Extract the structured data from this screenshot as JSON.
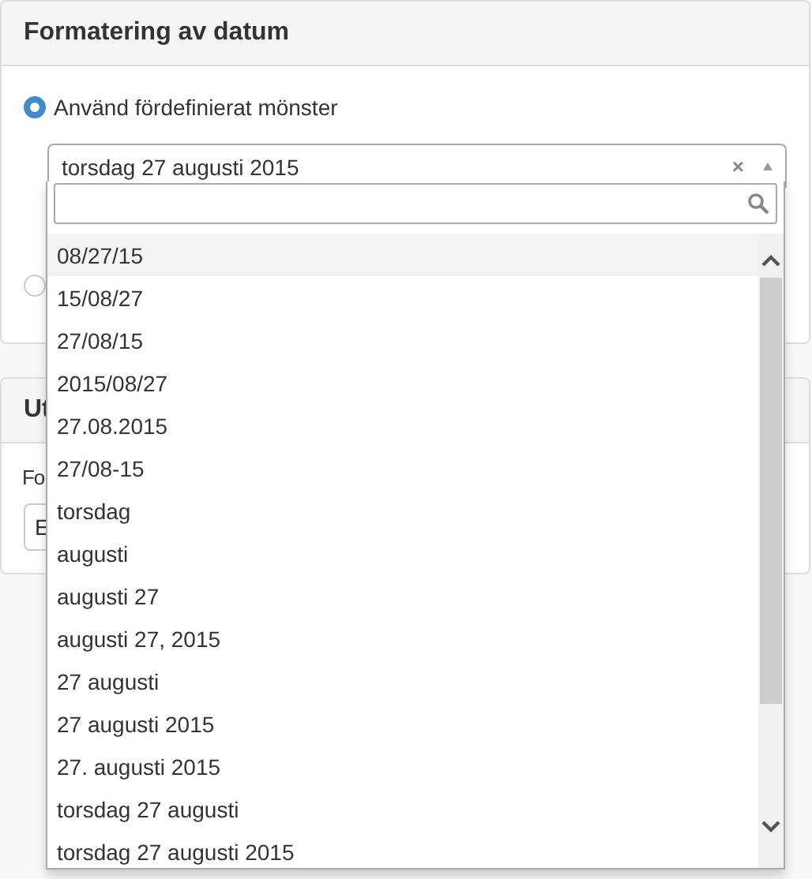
{
  "panels": [
    {
      "title": "Formatering av datum",
      "kind": "radios",
      "options": [
        {
          "label": "Använd fördefinierat mönster",
          "selected": true
        },
        {
          "selected": false
        }
      ],
      "select": {
        "value": "torsdag 27 augusti 2015",
        "clear": "×",
        "open": true
      }
    },
    {
      "title": "Ut",
      "kind": "field",
      "label": "Fo",
      "value": "E"
    }
  ],
  "dropdown": {
    "options": [
      {
        "label": "08/27/15",
        "selected": true
      },
      {
        "label": "15/08/27",
        "selected": false
      },
      {
        "label": "27/08/15",
        "selected": false
      },
      {
        "label": "2015/08/27",
        "selected": false
      },
      {
        "label": "27.08.2015",
        "selected": false
      },
      {
        "label": "27/08-15",
        "selected": false
      },
      {
        "label": "torsdag",
        "selected": false
      },
      {
        "label": "augusti",
        "selected": false
      },
      {
        "label": "augusti 27",
        "selected": false
      },
      {
        "label": "augusti 27, 2015",
        "selected": false
      },
      {
        "label": "27 augusti",
        "selected": false
      },
      {
        "label": "27 augusti 2015",
        "selected": false
      },
      {
        "label": "27. augusti 2015",
        "selected": false
      },
      {
        "label": "torsdag 27 augusti",
        "selected": false
      },
      {
        "label": "torsdag 27 augusti 2015",
        "selected": false
      }
    ]
  }
}
